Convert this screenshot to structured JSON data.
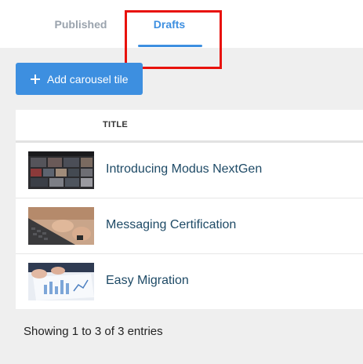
{
  "tabs": [
    {
      "label": "Published",
      "active": false
    },
    {
      "label": "Drafts",
      "active": true
    }
  ],
  "toolbar": {
    "add_label": "Add carousel tile",
    "add_icon": "plus-icon"
  },
  "table": {
    "columns": [
      "TITLE"
    ],
    "rows": [
      {
        "title": "Introducing Modus NextGen",
        "thumbnail": "video-dashboard-thumbnail"
      },
      {
        "title": "Messaging Certification",
        "thumbnail": "laptop-typing-thumbnail"
      },
      {
        "title": "Easy Migration",
        "thumbnail": "tablet-chart-thumbnail"
      }
    ]
  },
  "footer": {
    "entries_text": "Showing 1 to 3 of 3 entries"
  },
  "colors": {
    "accent": "#3d8fe0",
    "highlight": "#e8120c",
    "title_text": "#1e4a66",
    "inactive_tab": "#9aa3ad"
  }
}
